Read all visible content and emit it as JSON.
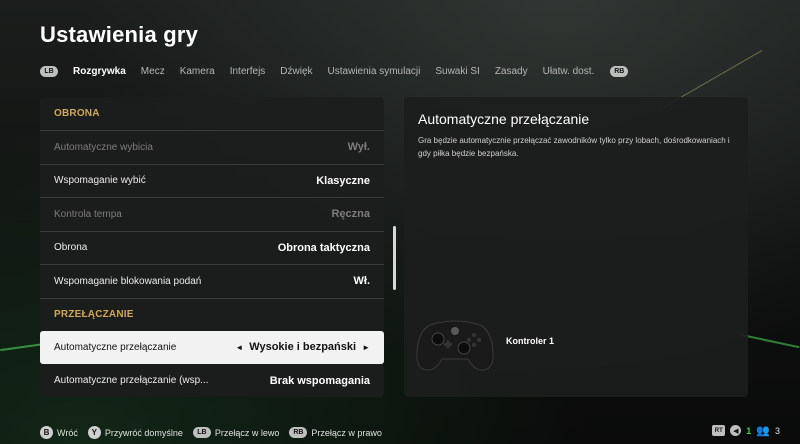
{
  "page": {
    "title": "Ustawienia gry"
  },
  "tabs": {
    "prev_badge": "LB",
    "next_badge": "RB",
    "items": [
      {
        "label": "Rozgrywka",
        "active": true
      },
      {
        "label": "Mecz"
      },
      {
        "label": "Kamera"
      },
      {
        "label": "Interfejs"
      },
      {
        "label": "Dźwięk"
      },
      {
        "label": "Ustawienia symulacji"
      },
      {
        "label": "Suwaki SI"
      },
      {
        "label": "Zasady"
      },
      {
        "label": "Ułatw. dost."
      }
    ]
  },
  "settings": {
    "section_defense": "OBRONA",
    "section_switching": "PRZEŁĄCZANIE",
    "rows": [
      {
        "label": "Automatyczne wybicia",
        "value": "Wył."
      },
      {
        "label": "Wspomaganie wybić",
        "value": "Klasyczne"
      },
      {
        "label": "Kontrola tempa",
        "value": "Ręczna"
      },
      {
        "label": "Obrona",
        "value": "Obrona taktyczna"
      },
      {
        "label": "Wspomaganie blokowania podań",
        "value": "Wł."
      },
      {
        "label": "Automatyczne przełączanie",
        "value": "Wysokie i bezpański"
      },
      {
        "label": "Automatyczne przełączanie (wsp...",
        "value": "Brak wspomagania"
      }
    ],
    "arrow_left": "◄",
    "arrow_right": "►"
  },
  "info": {
    "title": "Automatyczne przełączanie",
    "description": "Gra będzie automatycznie przełączać zawodników tylko przy lobach, dośrodkowaniach i gdy piłka będzie bezpańska.",
    "controller_label": "Kontroler 1"
  },
  "footer": {
    "back_badge": "B",
    "back_label": "Wróć",
    "reset_badge": "Y",
    "reset_label": "Przywróć domyślne",
    "left_badge": "LB",
    "left_label": "Przełącz w lewo",
    "right_badge": "RB",
    "right_label": "Przełącz w prawo"
  },
  "status": {
    "rt_badge": "RT",
    "voice_count": "1",
    "players_count": "3"
  },
  "colors": {
    "section_accent": "#d2a85a",
    "status_green": "#3fd24a"
  }
}
